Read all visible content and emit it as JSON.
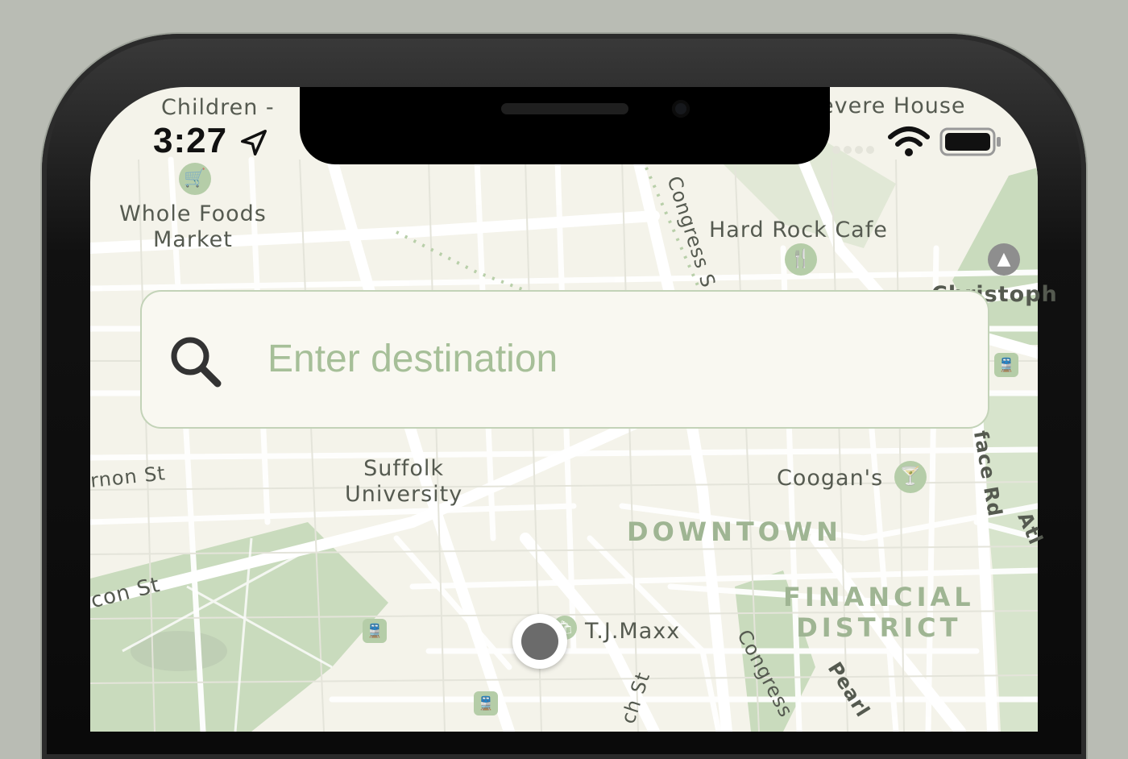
{
  "status_bar": {
    "time": "3:27"
  },
  "search": {
    "placeholder": "Enter destination"
  },
  "map_labels": {
    "children": "Children -",
    "revere_house": "evere House",
    "whole_foods": "Whole Foods\nMarket",
    "congress_top": "Congress S",
    "hard_rock": "Hard Rock Cafe",
    "christopher": "Christoph\nbus",
    "suffolk": "Suffolk\nUniversity",
    "vernon": "rnon St",
    "coogans": "Coogan's",
    "downtown": "DOWNTOWN",
    "financial": "FINANCIAL\nDISTRICT",
    "beacon": "con St",
    "tjmaxx": "T.J.Maxx",
    "congress_bottom": "Congress",
    "pearl": "Pearl",
    "face_rd": "face Rd",
    "ch_st": "ch St",
    "atl": "Atl"
  },
  "colors": {
    "map_bg": "#f4f3ea",
    "park": "#c9dbbd",
    "road": "#ffffff",
    "accent_green": "#a6bf98"
  }
}
